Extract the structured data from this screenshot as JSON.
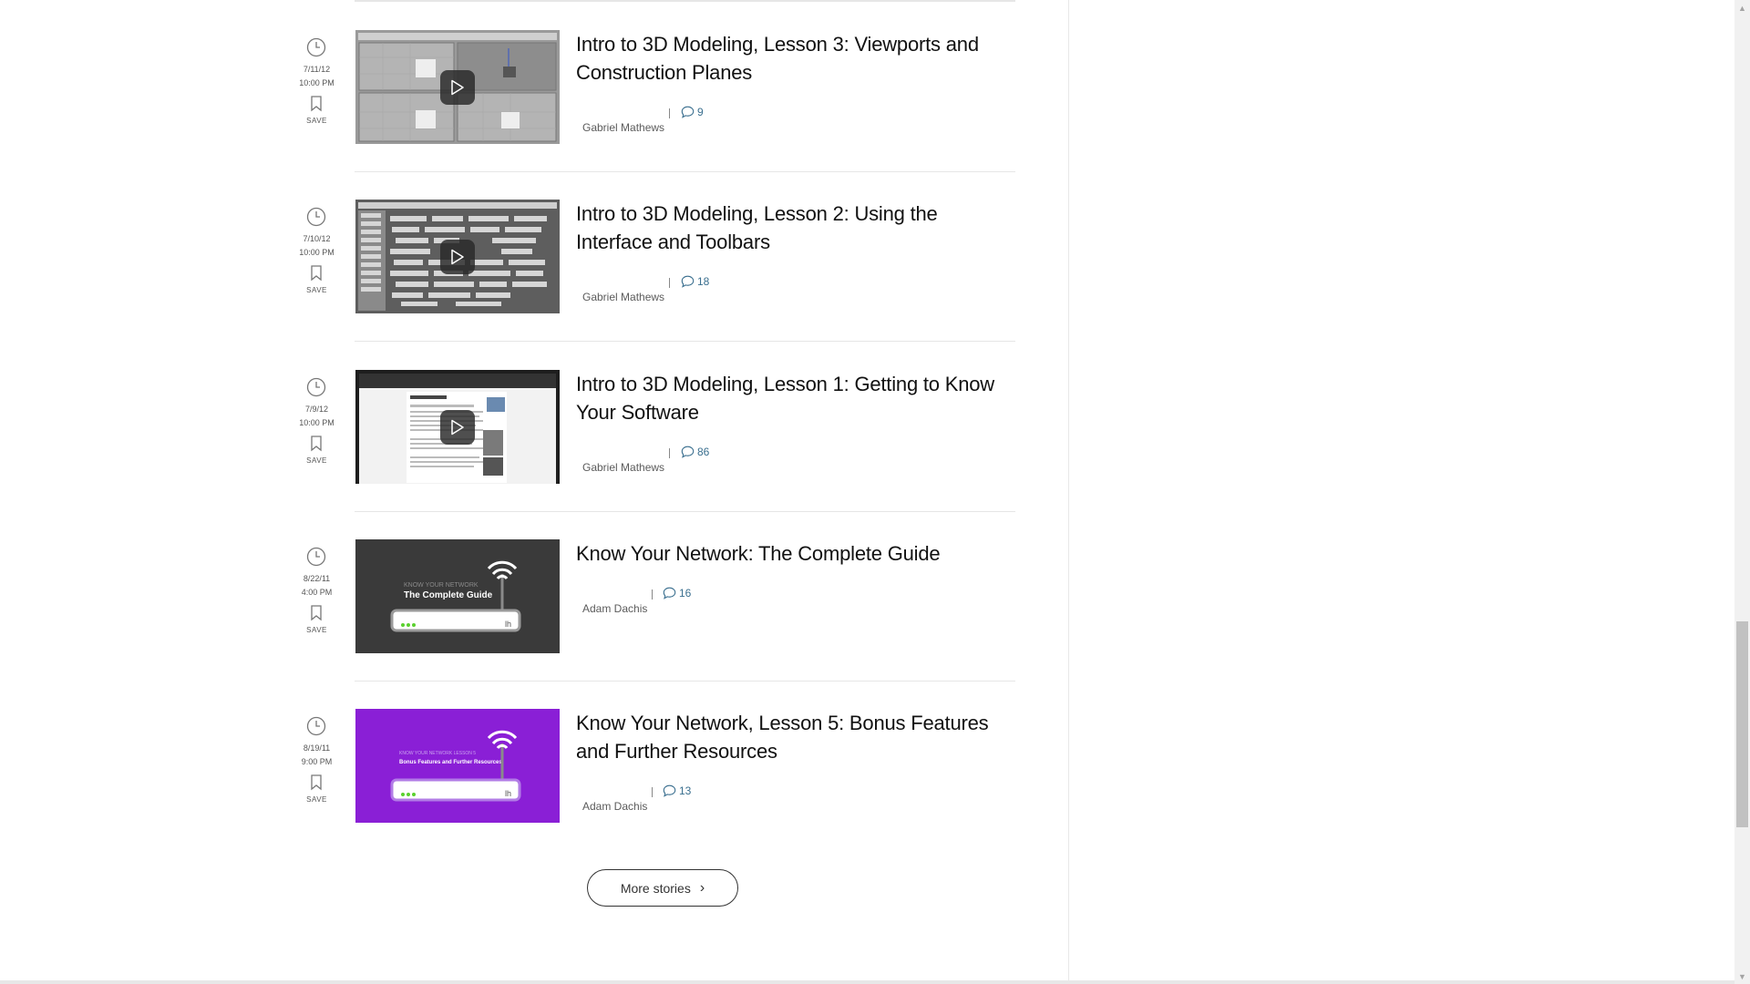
{
  "stories": [
    {
      "date": "7/11/12",
      "time": "10:00 PM",
      "save_label": "SAVE",
      "title": "Intro to 3D Modeling, Lesson 3: Viewports and Construction Planes",
      "author": "Gabriel Mathews",
      "comments": "9",
      "thumb_style": "viewports",
      "has_video": true
    },
    {
      "date": "7/10/12",
      "time": "10:00 PM",
      "save_label": "SAVE",
      "title": "Intro to 3D Modeling, Lesson 2: Using the Interface and Toolbars",
      "author": "Gabriel Mathews",
      "comments": "18",
      "thumb_style": "toolbars",
      "has_video": true
    },
    {
      "date": "7/9/12",
      "time": "10:00 PM",
      "save_label": "SAVE",
      "title": "Intro to 3D Modeling, Lesson 1: Getting to Know Your Software",
      "author": "Gabriel Mathews",
      "comments": "86",
      "thumb_style": "webpage",
      "has_video": true
    },
    {
      "date": "8/22/11",
      "time": "4:00 PM",
      "save_label": "SAVE",
      "title": "Know Your Network: The Complete Guide",
      "author": "Adam Dachis",
      "comments": "16",
      "thumb_style": "network-dark",
      "thumb_text": {
        "small": "KNOW YOUR NETWORK",
        "big": "The Complete Guide"
      },
      "has_video": false
    },
    {
      "date": "8/19/11",
      "time": "9:00 PM",
      "save_label": "SAVE",
      "title": "Know Your Network, Lesson 5: Bonus Features and Further Resources",
      "author": "Adam Dachis",
      "comments": "13",
      "thumb_style": "network-purple",
      "thumb_text": {
        "small": "KNOW YOUR NETWORK LESSON 5",
        "big": "Bonus Features and Further Resources"
      },
      "has_video": false
    }
  ],
  "more_button": {
    "label": "More stories"
  },
  "colors": {
    "comment_count": "#3a6f8f",
    "purple_thumb": "#8a1fd6",
    "dark_thumb": "#3a3a3a"
  }
}
